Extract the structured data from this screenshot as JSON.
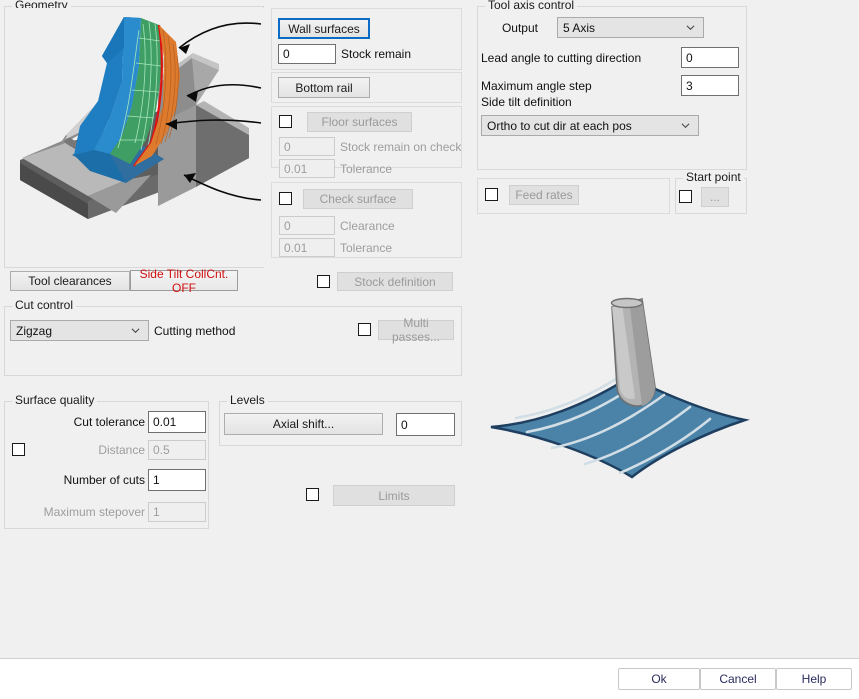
{
  "geometry": {
    "group_label": "Geometry",
    "preview_alt": "3d-machined-part-preview"
  },
  "surfaces": {
    "wall_surfaces_button": "Wall surfaces",
    "wall_stock_remain_value": "0",
    "wall_stock_remain_label": "Stock remain",
    "bottom_rail_button": "Bottom rail",
    "floor_surfaces_button": "Floor surfaces",
    "floor_stock_remain_value": "0",
    "floor_stock_remain_label": "Stock remain on check",
    "floor_tolerance_value": "0.01",
    "floor_tolerance_label": "Tolerance",
    "check_surface_button": "Check surface",
    "check_clearance_value": "0",
    "check_clearance_label": "Clearance",
    "check_tolerance_value": "0.01",
    "check_tolerance_label": "Tolerance"
  },
  "tool_axis": {
    "group_label": "Tool axis control",
    "output_label": "Output",
    "output_value": "5 Axis",
    "lead_angle_label": "Lead angle to cutting direction",
    "lead_angle_value": "0",
    "max_angle_step_label": "Maximum angle step",
    "max_angle_step_value": "3",
    "side_tilt_label": "Side tilt definition",
    "side_tilt_value": "Ortho to cut dir at each pos"
  },
  "feed_rates": {
    "button": "Feed rates"
  },
  "start_point": {
    "group_label": "Start point",
    "ellipsis_button": "..."
  },
  "clearances": {
    "tool_clearances_button": "Tool clearances",
    "side_tilt_collcnt_button": "Side Tilt CollCnt. OFF",
    "side_tilt_collcnt_color": "#d01010",
    "stock_definition_button": "Stock definition"
  },
  "cut_control": {
    "group_label": "Cut control",
    "cutting_method_value": "Zigzag",
    "cutting_method_label": "Cutting method",
    "multi_passes_button": "Multi passes..."
  },
  "surface_quality": {
    "group_label": "Surface quality",
    "cut_tolerance_label": "Cut tolerance",
    "cut_tolerance_value": "0.01",
    "distance_label": "Distance",
    "distance_value": "0.5",
    "number_of_cuts_label": "Number of cuts",
    "number_of_cuts_value": "1",
    "maximum_stepover_label": "Maximum stepover",
    "maximum_stepover_value": "1"
  },
  "levels": {
    "group_label": "Levels",
    "axial_shift_button": "Axial shift...",
    "axial_shift_value": "0",
    "limits_button": "Limits"
  },
  "tool_preview": {
    "alt": "tool-on-surface-preview"
  },
  "footer": {
    "ok": "Ok",
    "cancel": "Cancel",
    "help": "Help"
  }
}
